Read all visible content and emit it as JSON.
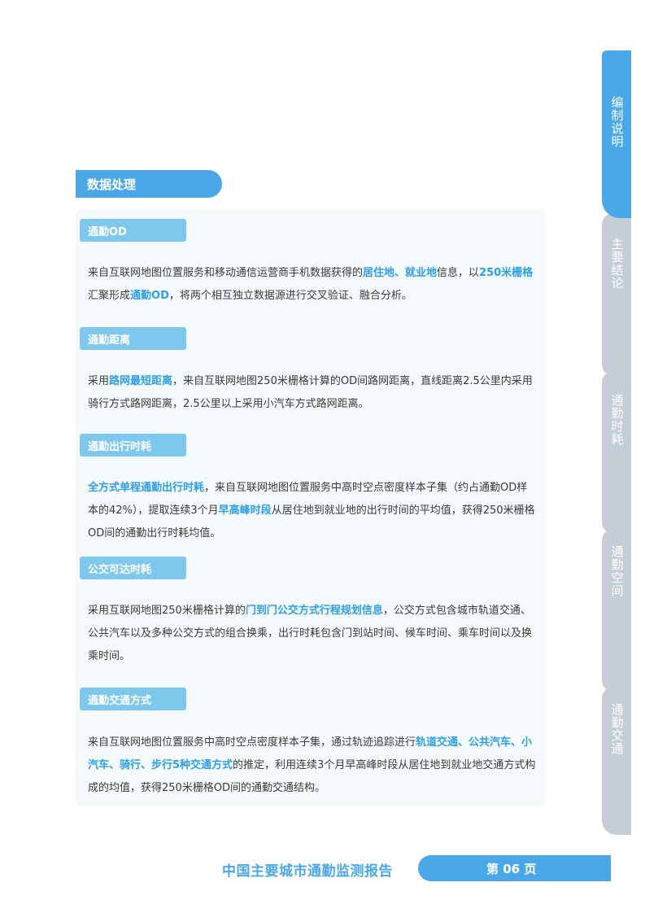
{
  "side_tabs": [
    {
      "label": "编制说明",
      "active": true
    },
    {
      "label": "主要结论",
      "active": false
    },
    {
      "label": "通勤时耗",
      "active": false
    },
    {
      "label": "通勤空间",
      "active": false
    },
    {
      "label": "通勤交通",
      "active": false
    }
  ],
  "section_title": "数据处理",
  "blocks": [
    {
      "title": "通勤OD",
      "p": [
        "来自互联网地图位置服务和移动通信运营商手机数据获得的",
        "居住地、就业地",
        "信息，以",
        "250米栅格",
        "汇聚形成",
        "通勤OD",
        "，将两个相互独立数据源进行交叉验证、融合分析。"
      ]
    },
    {
      "title": "通勤距离",
      "p": [
        "采用",
        "路网最短距离",
        "，来自互联网地图250米栅格计算的OD间路网距离，直线距离2.5公里内采用骑行方式路网距离，2.5公里以上采用小汽车方式路网距离。"
      ]
    },
    {
      "title": "通勤出行时耗",
      "p": [
        "全方式单程通勤出行时耗",
        "，来自互联网地图位置服务中高时空点密度样本子集（约占通勤OD样本的42%），提取连续3个月",
        "早高峰时段",
        "从居住地到就业地的出行时间的平均值，获得250米栅格OD间的通勤出行时耗均值。"
      ]
    },
    {
      "title": "公交可达时耗",
      "p": [
        "采用互联网地图250米栅格计算的",
        "门到门公交方式行程规划信息",
        "，公交方式包含城市轨道交通、公共汽车以及多种公交方式的组合换乘，出行时耗包含门到站时间、候车时间、乘车时间以及换乘时间。"
      ]
    },
    {
      "title": "通勤交通方式",
      "p": [
        "来自互联网地图位置服务中高时空点密度样本子集，通过轨迹追踪进行",
        "轨道交通、公共汽车、小汽车、骑行、步行5种交通方式",
        "的推定，利用连续3个月早高峰时段从居住地到就业地交通方式构成的均值，获得250米栅格OD间的通勤交通结构。"
      ]
    }
  ],
  "footer": {
    "report_title": "中国主要城市通勤监测报告",
    "page_label": "第 06 页"
  },
  "colors": {
    "accent": "#4aa8e8",
    "highlight": "#2e9fe6",
    "sub_header": "#7ec8ee",
    "inactive_tab": "#c5ced6"
  }
}
